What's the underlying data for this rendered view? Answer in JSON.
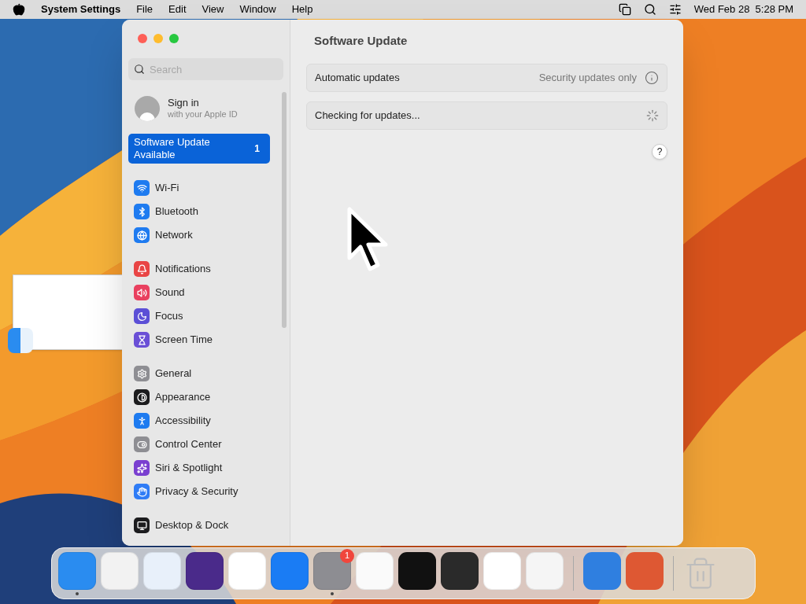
{
  "menu_bar": {
    "app": "System Settings",
    "menus": [
      "File",
      "Edit",
      "View",
      "Window",
      "Help"
    ],
    "clock": "Wed Feb 28  5:28 PM"
  },
  "window": {
    "title": "Software Update"
  },
  "sidebar": {
    "search": {
      "placeholder": "Search"
    },
    "account": {
      "title": "Sign in",
      "subtitle": "with your Apple ID"
    },
    "banner": {
      "label": "Software Update Available",
      "count": "1",
      "selected": true
    },
    "groups": [
      [
        {
          "label": "Wi-Fi",
          "color": "#1e7bf0"
        },
        {
          "label": "Bluetooth",
          "color": "#1e7bf0"
        },
        {
          "label": "Network",
          "color": "#1e7bf0"
        }
      ],
      [
        {
          "label": "Notifications",
          "color": "#e94545"
        },
        {
          "label": "Sound",
          "color": "#e9405f"
        },
        {
          "label": "Focus",
          "color": "#5b4fd6"
        },
        {
          "label": "Screen Time",
          "color": "#6a4fd6"
        }
      ],
      [
        {
          "label": "General",
          "color": "#8e8e93"
        },
        {
          "label": "Appearance",
          "color": "#1c1c1e"
        },
        {
          "label": "Accessibility",
          "color": "#1e7bf0"
        },
        {
          "label": "Control Center",
          "color": "#8e8e93"
        },
        {
          "label": "Siri & Spotlight",
          "color": "#7a3fd0"
        },
        {
          "label": "Privacy & Security",
          "color": "#2f7cf6"
        }
      ],
      [
        {
          "label": "Desktop & Dock",
          "color": "#1c1c1e"
        }
      ]
    ]
  },
  "rows": [
    {
      "label": "Automatic updates",
      "value": "Security updates only",
      "kind": "info"
    },
    {
      "label": "Checking for updates...",
      "kind": "spinner"
    }
  ],
  "help": "?",
  "dock": {
    "apps": [
      {
        "color": "#2a8cf0",
        "running": true
      },
      {
        "color": "#f2f2f2",
        "running": false
      },
      {
        "color": "#e8f0fa",
        "running": false
      },
      {
        "color": "#4a2a8a",
        "running": false
      },
      {
        "color": "#ffffff",
        "running": false
      },
      {
        "color": "#1a7cf4",
        "running": false
      },
      {
        "color": "#8d8d92",
        "running": true,
        "badge": "1"
      },
      {
        "color": "#fafafa",
        "running": false
      },
      {
        "color": "#111111",
        "running": false
      },
      {
        "color": "#2a2a2a",
        "running": false
      },
      {
        "color": "#ffffff",
        "running": false
      },
      {
        "color": "#f5f5f5",
        "running": false
      }
    ],
    "extras": [
      {
        "color": "#2f7fe0"
      },
      {
        "color": "#de5833"
      }
    ]
  }
}
